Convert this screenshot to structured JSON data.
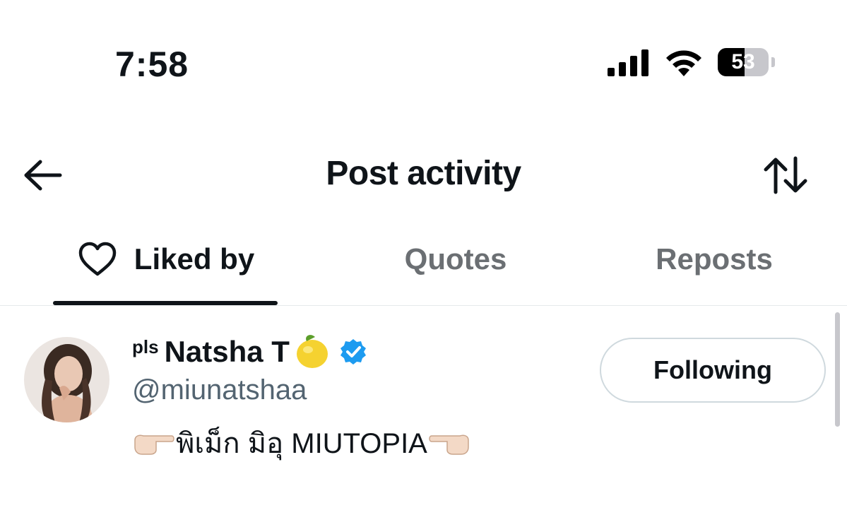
{
  "status_bar": {
    "time": "7:58",
    "battery_level": "53",
    "battery_fraction": 0.53
  },
  "header": {
    "title": "Post activity",
    "back_icon": "arrow-left-icon",
    "sort_icon": "sort-arrows-icon"
  },
  "tabs": [
    {
      "label": "Liked by",
      "icon": "heart-icon",
      "active": true
    },
    {
      "label": "Quotes",
      "active": false
    },
    {
      "label": "Reposts",
      "active": false
    }
  ],
  "users": [
    {
      "name_prefix": "pls",
      "name": "Natsha T",
      "handle": "@miunatshaa",
      "verified": true,
      "bio": "พิเม็ก มิอุ MIUTOPIA",
      "button_label": "Following"
    }
  ],
  "colors": {
    "text_primary": "#0f1419",
    "text_secondary": "#536471",
    "tab_inactive": "#6b6f73",
    "verified_blue": "#1d9bf0",
    "border": "#cfd9de"
  }
}
